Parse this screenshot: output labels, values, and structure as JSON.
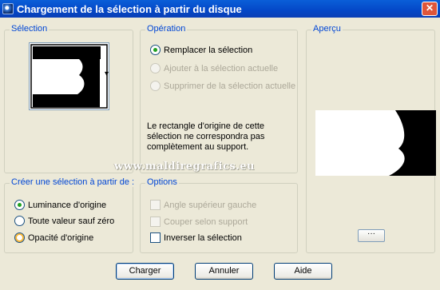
{
  "window": {
    "title": "Chargement de la sélection à partir du disque",
    "close_glyph": "✕"
  },
  "selection_group": {
    "title": "Sélection",
    "dropdown_arrow": "▾"
  },
  "operation_group": {
    "title": "Opération",
    "options": [
      "Remplacer la sélection",
      "Ajouter à la sélection actuelle",
      "Supprimer de la sélection actuelle"
    ],
    "selected": "Remplacer la sélection",
    "message": "Le rectangle d'origine de cette sélection ne correspondra pas complètement au support."
  },
  "preview_group": {
    "title": "Aperçu"
  },
  "create_group": {
    "title": "Créer une sélection à partir de :",
    "options": [
      "Luminance d'origine",
      "Toute valeur sauf zéro",
      "Opacité d'origine"
    ],
    "selected": "Luminance d'origine"
  },
  "options_group": {
    "title": "Options",
    "checkboxes": [
      {
        "label": "Angle supérieur gauche",
        "checked": false,
        "enabled": false
      },
      {
        "label": "Couper selon support",
        "checked": false,
        "enabled": false
      },
      {
        "label": "Inverser la sélection",
        "checked": false,
        "enabled": true
      }
    ]
  },
  "watermark": "www.maldiregrafics.eu",
  "buttons": {
    "load": "Charger",
    "cancel": "Annuler",
    "help": "Aide"
  },
  "colors": {
    "title_bar": "#0447c7",
    "group_title": "#0046d5",
    "dialog_bg": "#ece9d8"
  }
}
